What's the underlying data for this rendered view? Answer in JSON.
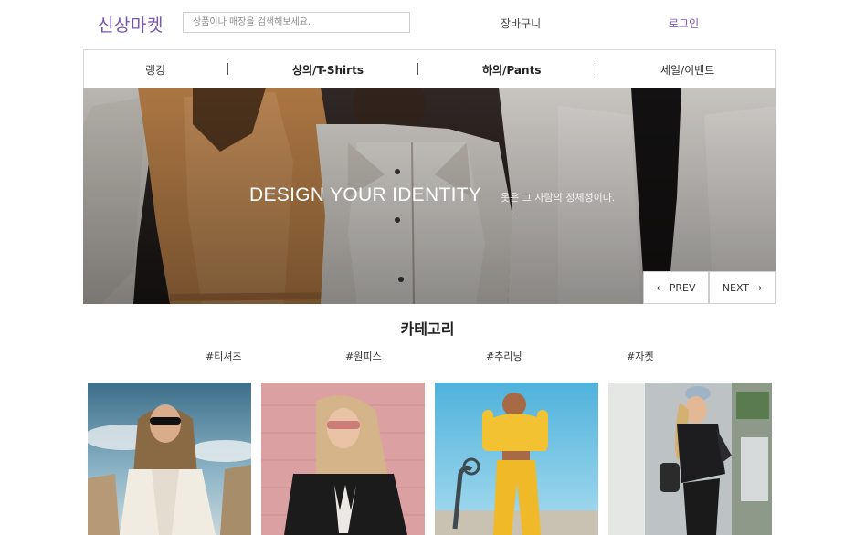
{
  "header": {
    "logo": "신상마켓",
    "search_placeholder": "상품이나 매장을 검색해보세요.",
    "cart_label": "장바구니",
    "login_label": "로그인"
  },
  "nav": {
    "items": [
      {
        "label": "랭킹"
      },
      {
        "label": "상의/T-Shirts"
      },
      {
        "label": "하의/Pants"
      },
      {
        "label": "세일/이벤트"
      }
    ]
  },
  "hero": {
    "title": "DESIGN YOUR IDENTITY",
    "subtitle": "옷은 그 사람의 정체성이다.",
    "prev_label": "PREV",
    "next_label": "NEXT",
    "prev_arrow": "←",
    "next_arrow": "→"
  },
  "category": {
    "title": "카테고리",
    "tags": [
      "#티셔츠",
      "#원피스",
      "#추리닝",
      "#자켓"
    ]
  },
  "colors": {
    "brand": "#7b55b5"
  }
}
